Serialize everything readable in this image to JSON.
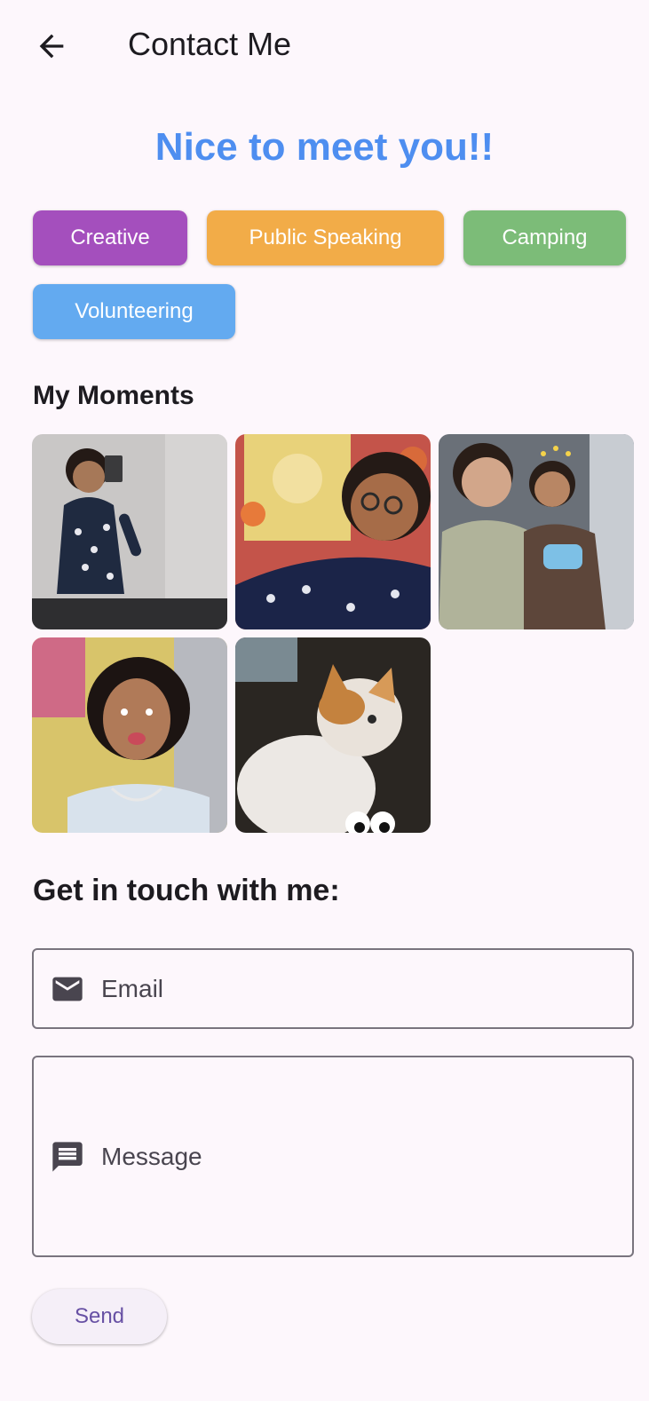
{
  "appbar": {
    "title": "Contact Me",
    "back_icon": "arrow-back-icon"
  },
  "greeting": "Nice to meet you!!",
  "interests": [
    {
      "label": "Creative",
      "color": "#a44fbd"
    },
    {
      "label": "Public Speaking",
      "color": "#f2ac48"
    },
    {
      "label": "Camping",
      "color": "#7cbc78"
    },
    {
      "label": "Volunteering",
      "color": "#63aaf0"
    }
  ],
  "moments": {
    "title": "My Moments",
    "photos": [
      {
        "name": "photo-mirror-selfie"
      },
      {
        "name": "photo-selfie-artwork"
      },
      {
        "name": "photo-two-friends"
      },
      {
        "name": "photo-selfie-filter"
      },
      {
        "name": "photo-cat"
      }
    ]
  },
  "contact": {
    "title": "Get in touch with me:",
    "email_label": "Email",
    "email_icon": "mail-icon",
    "message_label": "Message",
    "message_icon": "message-icon",
    "send_label": "Send"
  }
}
